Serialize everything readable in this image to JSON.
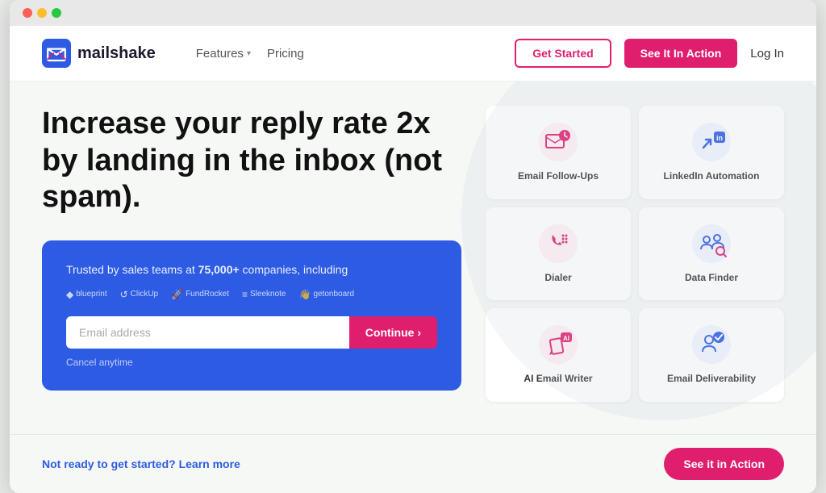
{
  "browser": {
    "dots": [
      "red",
      "yellow",
      "green"
    ]
  },
  "navbar": {
    "logo_text": "mailshake",
    "logo_sup": "™",
    "nav_items": [
      {
        "label": "Features",
        "has_chevron": true
      },
      {
        "label": "Pricing",
        "has_chevron": false
      }
    ],
    "btn_get_started": "Get Started",
    "btn_see_action": "See It In Action",
    "btn_login": "Log In"
  },
  "hero": {
    "title": "Increase your reply rate 2x by landing in the inbox (not spam).",
    "cta_box": {
      "trusted_text": "Trusted by sales teams at ",
      "trusted_count": "75,000+",
      "trusted_suffix": " companies, including",
      "companies": [
        {
          "symbol": "◆",
          "name": "blueprint"
        },
        {
          "symbol": "↺",
          "name": "ClickUp"
        },
        {
          "symbol": "🚀",
          "name": "FundRocket"
        },
        {
          "symbol": "≡",
          "name": "Sleeknote"
        },
        {
          "symbol": "👋",
          "name": "getonboard"
        }
      ],
      "email_placeholder": "Email address",
      "btn_continue": "Continue ›",
      "cancel_text": "Cancel anytime"
    }
  },
  "features": [
    {
      "id": "email-followups",
      "label": "Email Follow-Ups",
      "icon_color": "#e01e6e",
      "icon_type": "email-followups"
    },
    {
      "id": "linkedin-automation",
      "label": "LinkedIn Automation",
      "icon_color": "#2d5be3",
      "icon_type": "linkedin"
    },
    {
      "id": "dialer",
      "label": "Dialer",
      "icon_color": "#e01e6e",
      "icon_type": "dialer"
    },
    {
      "id": "data-finder",
      "label": "Data Finder",
      "icon_color": "#2d5be3",
      "icon_type": "data-finder"
    },
    {
      "id": "ai-email-writer",
      "label": "AI Email Writer",
      "icon_color": "#e01e6e",
      "icon_type": "ai-writer"
    },
    {
      "id": "email-deliverability",
      "label": "Email Deliverability",
      "icon_color": "#2d5be3",
      "icon_type": "deliverability"
    }
  ],
  "footer": {
    "not_ready_text": "Not ready to get started? Learn more",
    "btn_see_action": "See it in Action"
  }
}
